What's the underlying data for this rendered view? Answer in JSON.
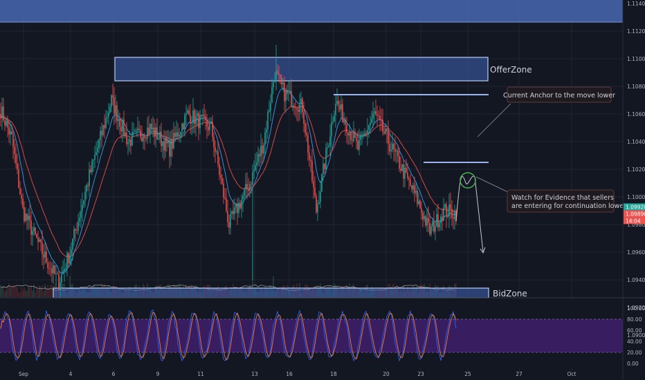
{
  "chart_data": {
    "type": "candlestick",
    "price_axis": {
      "ticks": [
        "1.11400",
        "1.11200",
        "1.11000",
        "1.10800",
        "1.10600",
        "1.10400",
        "1.10200",
        "1.10000",
        "1.09800",
        "1.09600",
        "1.09400",
        "1.09200",
        "1.09000"
      ],
      "current_price": "1.09928",
      "alt_price": "1.09890",
      "countdown": "14:04"
    },
    "osc_axis": {
      "ticks": [
        "100.00",
        "80.00",
        "60.00",
        "40.00",
        "20.00",
        "0.00"
      ],
      "band": [
        20,
        80
      ]
    },
    "time_axis": {
      "ticks": [
        "Sep",
        "4",
        "6",
        "9",
        "11",
        "13",
        "16",
        "18",
        "20",
        "23",
        "25",
        "27",
        "Oct"
      ]
    },
    "zones": [
      {
        "name": "OfferZone",
        "top": 1.1101,
        "bottom": 1.1084
      },
      {
        "name": "BidZone",
        "top": 1.0934,
        "bottom": 1.0927
      }
    ],
    "levels": [
      {
        "name": "swing-high",
        "price": 1.1074
      },
      {
        "name": "anchor",
        "price": 1.1025
      }
    ],
    "annotations": [
      {
        "id": "anchor",
        "text": "Current Anchor to the move lower"
      },
      {
        "id": "sellers",
        "lines": [
          "Watch for Evidence that sellers",
          "are entering for continuation lower"
        ]
      }
    ],
    "key_points": [
      [
        0,
        1.1063
      ],
      [
        8,
        1.1042
      ],
      [
        16,
        1.099
      ],
      [
        30,
        1.096
      ],
      [
        42,
        1.0938
      ],
      [
        50,
        1.096
      ],
      [
        64,
        1.1015
      ],
      [
        80,
        1.107
      ],
      [
        92,
        1.104
      ],
      [
        108,
        1.105
      ],
      [
        122,
        1.1035
      ],
      [
        135,
        1.106
      ],
      [
        152,
        1.105
      ],
      [
        165,
        1.098
      ],
      [
        180,
        1.101
      ],
      [
        190,
        1.104
      ],
      [
        198,
        1.109
      ],
      [
        205,
        1.1075
      ],
      [
        218,
        1.1065
      ],
      [
        228,
        1.099
      ],
      [
        242,
        1.107
      ],
      [
        258,
        1.1035
      ],
      [
        270,
        1.106
      ],
      [
        285,
        1.103
      ],
      [
        300,
        1.1
      ],
      [
        310,
        1.0975
      ],
      [
        320,
        1.099
      ],
      [
        330,
        1.0988
      ]
    ]
  }
}
